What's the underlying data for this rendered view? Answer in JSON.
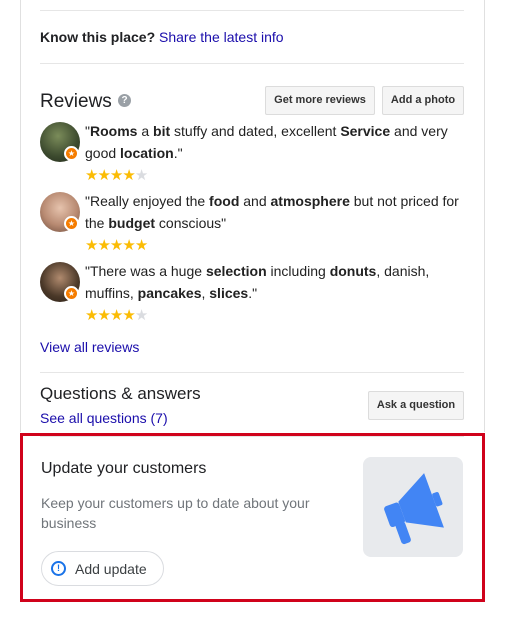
{
  "know": {
    "label": "Know this place?",
    "link": "Share the latest info"
  },
  "reviews": {
    "title": "Reviews",
    "help_icon": "question-circle-icon",
    "get_more_label": "Get more reviews",
    "add_photo_label": "Add a photo",
    "items": [
      {
        "parts": [
          [
            "\"",
            0
          ],
          [
            "Rooms",
            1
          ],
          [
            " a ",
            0
          ],
          [
            "bit",
            1
          ],
          [
            " stuffy and dated, excellent ",
            0
          ],
          [
            "Service",
            1
          ],
          [
            " and very good ",
            0
          ],
          [
            "location",
            1
          ],
          [
            ".\"",
            0
          ]
        ],
        "rating": 4
      },
      {
        "parts": [
          [
            "\"Really enjoyed the ",
            0
          ],
          [
            "food",
            1
          ],
          [
            " and ",
            0
          ],
          [
            "atmosphere",
            1
          ],
          [
            " but not priced for the ",
            0
          ],
          [
            "budget",
            1
          ],
          [
            " conscious\"",
            0
          ]
        ],
        "rating": 5
      },
      {
        "parts": [
          [
            "\"There was a huge ",
            0
          ],
          [
            "selection",
            1
          ],
          [
            " including ",
            0
          ],
          [
            "donuts",
            1
          ],
          [
            ", danish, muffins, ",
            0
          ],
          [
            "pancakes",
            1
          ],
          [
            ", ",
            0
          ],
          [
            "slices",
            1
          ],
          [
            ".\"",
            0
          ]
        ],
        "rating": 4
      }
    ],
    "view_all_label": "View all reviews"
  },
  "qa": {
    "title": "Questions & answers",
    "see_all_label": "See all questions (7)",
    "ask_label": "Ask a question"
  },
  "update": {
    "title": "Update your customers",
    "description": "Keep your customers up to date about your business",
    "add_label": "Add update",
    "icon": "megaphone-icon"
  },
  "colors": {
    "highlight": "#d0021b",
    "link": "#1a0dab",
    "star": "#fbbc04",
    "megaphone": "#4285f4"
  }
}
